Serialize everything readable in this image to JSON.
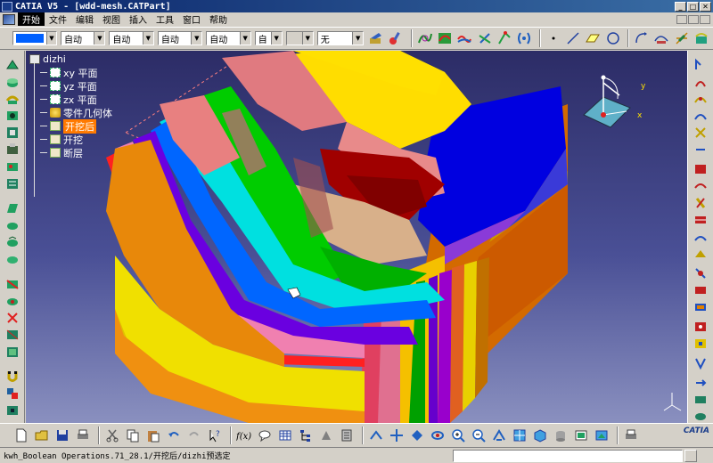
{
  "window": {
    "title": "CATIA V5 - [wdd-mesh.CATPart]",
    "min_label": "_",
    "max_label": "□",
    "close_label": "✕"
  },
  "menubar": {
    "items": [
      "开始",
      "文件",
      "编辑",
      "视图",
      "插入",
      "工具",
      "窗口",
      "帮助"
    ]
  },
  "toolbar": {
    "color_combo": "",
    "combo1": "自动",
    "combo2": "自动",
    "combo3": "自动",
    "combo4": "自动",
    "combo5": "自",
    "combo6": "",
    "combo7": "无"
  },
  "tree": {
    "root": "dizhi",
    "planes": [
      "xy 平面",
      "yz 平面",
      "zx 平面"
    ],
    "geometry": "零件几何体",
    "bodies": [
      "开挖后",
      "开挖",
      "断层"
    ],
    "selected": "开挖后"
  },
  "compass": {
    "x_label": "x",
    "y_label": "y"
  },
  "status": {
    "text": "kwh_Boolean Operations.71_28.1/开挖后/dizhi预选定"
  },
  "brand": {
    "logo_text": "CATIA"
  },
  "colors": {
    "title_bar": "#0a246a",
    "viewport_top": "#2c2c66",
    "viewport_bottom": "#8a90bf",
    "selection": "#ff7a00"
  },
  "icons": {
    "left_toolbar": [
      "sketch-icon",
      "pad-icon",
      "revolve-icon",
      "hole-icon",
      "fillet-icon",
      "chamfer-icon",
      "shell-icon",
      "thickness-icon",
      "draft-icon",
      "mirror-icon",
      "pattern-icon",
      "scale-icon",
      "split-icon",
      "thick-surface-icon",
      "close-surface-icon",
      "sew-icon",
      "remove-icon",
      "boolean-icon",
      "add-icon",
      "union-trim-icon",
      "magnet-icon",
      "measure-icon",
      "apply-material-icon"
    ],
    "right_toolbar": [
      "point-icon",
      "line-icon",
      "plane-icon",
      "projection-icon",
      "intersection-icon",
      "extrude-icon",
      "revolve-surface-icon",
      "sphere-icon",
      "cylinder-icon",
      "offset-icon",
      "sweep-icon",
      "fill-icon",
      "multisection-icon",
      "blend-icon",
      "join-icon",
      "healing-icon",
      "split-surface-icon",
      "trim-icon",
      "boundary-icon",
      "extract-icon",
      "fillet-surface-icon",
      "translate-icon",
      "rotate-icon",
      "symmetry-icon",
      "extrapolate-icon"
    ],
    "top_toolbar": [
      "paint-icon",
      "brush-icon",
      "curve-icon",
      "spline-icon",
      "helix-icon",
      "spiral-icon",
      "spine-icon",
      "isoparametric-icon",
      "point-icon",
      "line-icon",
      "plane-icon",
      "circle-icon",
      "connect-icon",
      "polyline-icon",
      "axis-icon",
      "corner-icon"
    ],
    "bottom_toolbar": [
      "new-icon",
      "open-icon",
      "save-icon",
      "print-icon",
      "cut-icon",
      "copy-icon",
      "paste-icon",
      "undo-icon",
      "redo-icon",
      "whats-this-icon",
      "formula-icon",
      "comment-icon",
      "table-icon",
      "tree-icon",
      "part-icon",
      "catalog-icon",
      "fly-icon",
      "fit-all-icon",
      "pan-icon",
      "rotate-view-icon",
      "zoom-in-icon",
      "zoom-out-icon",
      "normal-view-icon",
      "multi-view-icon",
      "iso-view-icon",
      "hide-show-icon",
      "swap-icon",
      "render-icon"
    ]
  }
}
